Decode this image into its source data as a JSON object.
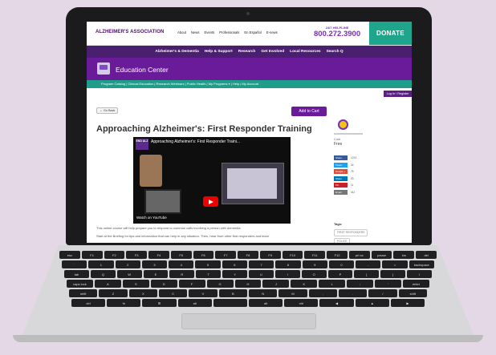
{
  "site": {
    "logo": "ALZHEIMER'S ASSOCIATION",
    "top_links": [
      "About",
      "News",
      "Events",
      "Professionals",
      "En Español",
      "E-news"
    ],
    "helpline_label": "24/7 HELPLINE",
    "helpline_number": "800.272.3900",
    "donate": "DONATE",
    "main_nav": [
      "Alzheimer's & Dementia",
      "Help & Support",
      "Research",
      "Get Involved",
      "Local Resources",
      "Search Q"
    ],
    "section_title": "Education Center",
    "program_links": "Program Catalog  |  Clinical Education  |  Research Webinars  |  Public Health  |  My Programs ▾  |  Help  |  My Account",
    "login": "Log In / Register"
  },
  "content": {
    "go_back": "← Go Back",
    "add_to_cart": "Add to Cart",
    "title": "Approaching Alzheimer's: First Responder Training",
    "video": {
      "badge": "END ALZ",
      "title": "Approaching Alzheimer's: First Responder Traini...",
      "watch_on": "Watch on YouTube"
    },
    "desc_1": "This online course will help prepare you to respond to common calls involving a person with dementia.",
    "desc_2": "Start at the Briefing for tips and information that can help in any situation. Then, hear from other first responders and learn"
  },
  "sidebar": {
    "cost_label": "Cost",
    "cost_value": "Free",
    "share": [
      {
        "label": "Share",
        "count": "1074",
        "color": "#3b5998"
      },
      {
        "label": "Tweet",
        "count": "34",
        "color": "#1da1f2"
      },
      {
        "label": "Google +",
        "count": "76",
        "color": "#dd4b39"
      },
      {
        "label": "Share",
        "count": "93",
        "color": "#0077b5"
      },
      {
        "label": "Pin",
        "count": "11",
        "color": "#cb2027"
      },
      {
        "label": "Email",
        "count": "412",
        "color": "#777777"
      }
    ],
    "tags_label": "Tags:",
    "tags": [
      "FIRST RESPONDERS",
      "POLICE"
    ]
  },
  "keyboard": {
    "row1": [
      "esc",
      "F1",
      "F2",
      "F3",
      "F4",
      "F5",
      "F6",
      "F7",
      "F8",
      "F9",
      "F10",
      "F11",
      "F12",
      "prt sc",
      "pause",
      "ins",
      "del"
    ],
    "row2": [
      "`",
      "1",
      "2",
      "3",
      "4",
      "5",
      "6",
      "7",
      "8",
      "9",
      "0",
      "-",
      "=",
      "backspace"
    ],
    "row3": [
      "tab",
      "Q",
      "W",
      "E",
      "R",
      "T",
      "Y",
      "U",
      "I",
      "O",
      "P",
      "[",
      "]",
      "\\"
    ],
    "row4": [
      "caps lock",
      "A",
      "S",
      "D",
      "F",
      "G",
      "H",
      "J",
      "K",
      "L",
      ";",
      "'",
      "enter"
    ],
    "row5": [
      "shift",
      "Z",
      "X",
      "C",
      "V",
      "B",
      "N",
      "M",
      ",",
      ".",
      "/",
      "shift"
    ],
    "row6": [
      "ctrl",
      "fn",
      "⊞",
      "alt",
      "",
      "alt",
      "ctrl",
      "◀",
      "▲",
      "▶"
    ]
  },
  "colors": {
    "purple": "#4b1f6f",
    "edu_purple": "#6a1b9a",
    "teal": "#1e9e8a",
    "donate": "#1ea58c"
  }
}
